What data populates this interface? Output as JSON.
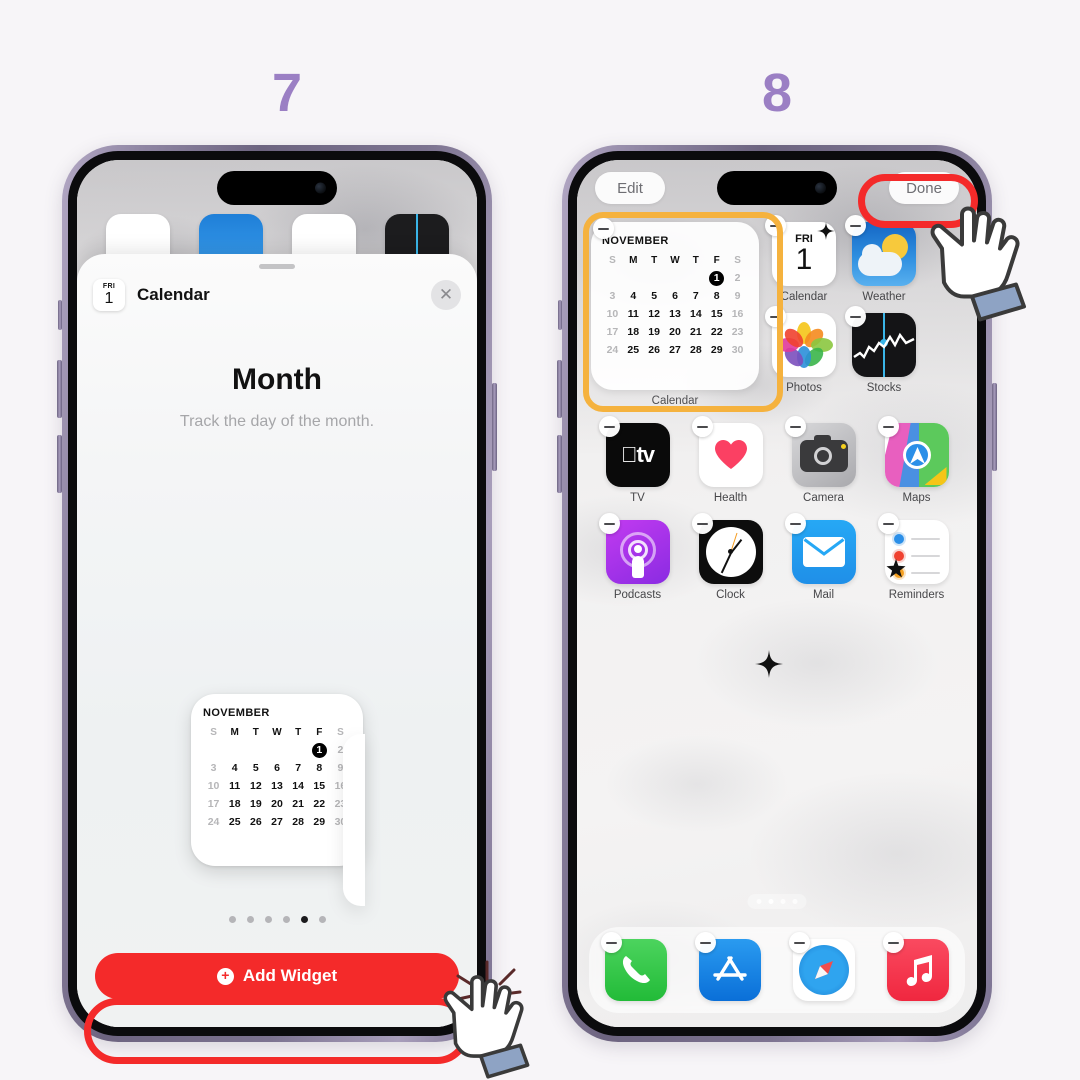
{
  "steps": {
    "left": "7",
    "right": "8",
    "color": "#9b7fc4"
  },
  "phone7": {
    "sheet": {
      "app_icon_dow": "FRI",
      "app_icon_day": "1",
      "title": "Calendar",
      "close_icon": "close-icon",
      "widget_name": "Month",
      "widget_description": "Track the day of the month."
    },
    "page_dots": {
      "count": 6,
      "active_index": 4
    },
    "add_button": {
      "label": "Add Widget",
      "icon": "plus-circle-icon",
      "color": "#f42a2a"
    },
    "background_apps": [
      "Calendar",
      "Weather",
      "Photos",
      "Stocks"
    ],
    "highlight_color": "#f42a2a"
  },
  "phone8": {
    "edit_label": "Edit",
    "done_label": "Done",
    "widget": {
      "label": "Calendar",
      "highlight_color": "#f5b23e"
    },
    "apps_row1": [
      {
        "name": "Calendar",
        "icon": "calendar-icon",
        "dow": "FRI",
        "day": "1"
      },
      {
        "name": "Weather",
        "icon": "weather-icon"
      }
    ],
    "apps_row2": [
      {
        "name": "Photos",
        "icon": "photos-icon"
      },
      {
        "name": "Stocks",
        "icon": "stocks-icon"
      }
    ],
    "apps_grid": [
      {
        "name": "TV",
        "icon": "tv-icon"
      },
      {
        "name": "Health",
        "icon": "health-icon"
      },
      {
        "name": "Camera",
        "icon": "camera-icon"
      },
      {
        "name": "Maps",
        "icon": "maps-icon"
      },
      {
        "name": "Podcasts",
        "icon": "podcasts-icon"
      },
      {
        "name": "Clock",
        "icon": "clock-icon"
      },
      {
        "name": "Mail",
        "icon": "mail-icon"
      },
      {
        "name": "Reminders",
        "icon": "reminders-icon"
      }
    ],
    "dock": [
      {
        "name": "Phone",
        "icon": "phone-icon"
      },
      {
        "name": "App Store",
        "icon": "appstore-icon"
      },
      {
        "name": "Safari",
        "icon": "safari-icon"
      },
      {
        "name": "Music",
        "icon": "music-icon"
      }
    ],
    "page_dots": {
      "count": 4,
      "active_index": 1
    },
    "highlight_color": "#f42a2a"
  },
  "calendar_widget": {
    "month": "NOVEMBER",
    "weekday_headers": [
      "S",
      "M",
      "T",
      "W",
      "T",
      "F",
      "S"
    ],
    "today": 1,
    "weeks": [
      [
        "",
        "",
        "",
        "",
        "",
        "1",
        "2"
      ],
      [
        "3",
        "4",
        "5",
        "6",
        "7",
        "8",
        "9"
      ],
      [
        "10",
        "11",
        "12",
        "13",
        "14",
        "15",
        "16"
      ],
      [
        "17",
        "18",
        "19",
        "20",
        "21",
        "22",
        "23"
      ],
      [
        "24",
        "25",
        "26",
        "27",
        "28",
        "29",
        "30"
      ]
    ]
  }
}
